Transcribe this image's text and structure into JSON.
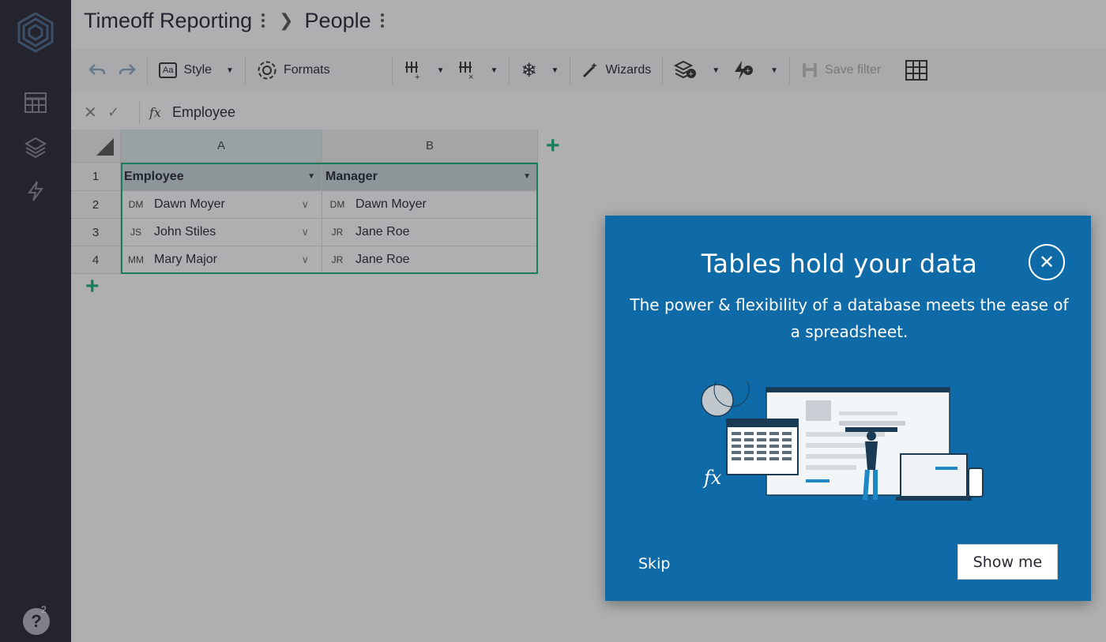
{
  "breadcrumb": {
    "doc_title": "Timeoff Reporting",
    "page_title": "People"
  },
  "sidebar": {
    "icons": [
      "logo-icon",
      "tables-icon",
      "layers-icon",
      "lightning-icon"
    ],
    "help_badge": "2"
  },
  "toolbar": {
    "style_label": "Style",
    "style_icon_text": "Aa",
    "formats_label": "Formats",
    "wizards_label": "Wizards",
    "save_filter_label": "Save filter"
  },
  "formula_bar": {
    "fx_label": "fx",
    "value": "Employee"
  },
  "grid": {
    "columns": [
      "A",
      "B"
    ],
    "rows": [
      "1",
      "2",
      "3",
      "4"
    ],
    "headers": [
      "Employee",
      "Manager"
    ],
    "data": [
      {
        "emp_ini": "DM",
        "emp": "Dawn Moyer",
        "mgr_ini": "DM",
        "mgr": "Dawn Moyer"
      },
      {
        "emp_ini": "JS",
        "emp": "John Stiles",
        "mgr_ini": "JR",
        "mgr": "Jane Roe"
      },
      {
        "emp_ini": "MM",
        "emp": "Mary Major",
        "mgr_ini": "JR",
        "mgr": "Jane Roe"
      }
    ]
  },
  "modal": {
    "title": "Tables hold your data",
    "body": "The power & flexibility of a database meets the ease of a spreadsheet.",
    "illustration_label": "fx",
    "skip_label": "Skip",
    "show_label": "Show me"
  },
  "colors": {
    "rail": "#262633",
    "accent": "#16b378",
    "modal_bg": "#0f6ba8",
    "header_fill": "#c9d8da"
  }
}
